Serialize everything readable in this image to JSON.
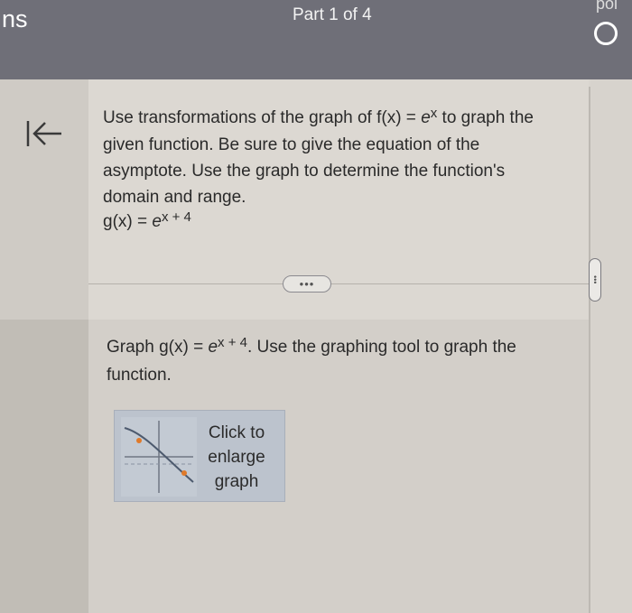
{
  "header": {
    "left_text": "ns",
    "center_text": "Part 1 of 4",
    "right_text": "poi",
    "status_icon": "circle-icon"
  },
  "nav": {
    "back_icon": "back-to-start-icon"
  },
  "question": {
    "line1_pre": "Use transformations of the graph of f(x) = ",
    "base_e": "e",
    "exp1": "x",
    "line1_post": " to",
    "rest": "graph the given function. Be sure to give the equation of the asymptote. Use the graph to determine the function's domain and range.",
    "formula_pre": "g(x) = ",
    "formula_base": "e",
    "formula_exp": "x + 4"
  },
  "more_button": {
    "label": "•••"
  },
  "side_handle": {
    "label": "•••"
  },
  "part": {
    "pre": "Graph g(x) = ",
    "base": "e",
    "exp": "x + 4",
    "post": ". Use the graphing tool to graph the function."
  },
  "graph_button": {
    "label": "Click to enlarge graph"
  },
  "colors": {
    "header_bg": "#6f6f78",
    "graph_button_bg": "#bcc3cd"
  }
}
